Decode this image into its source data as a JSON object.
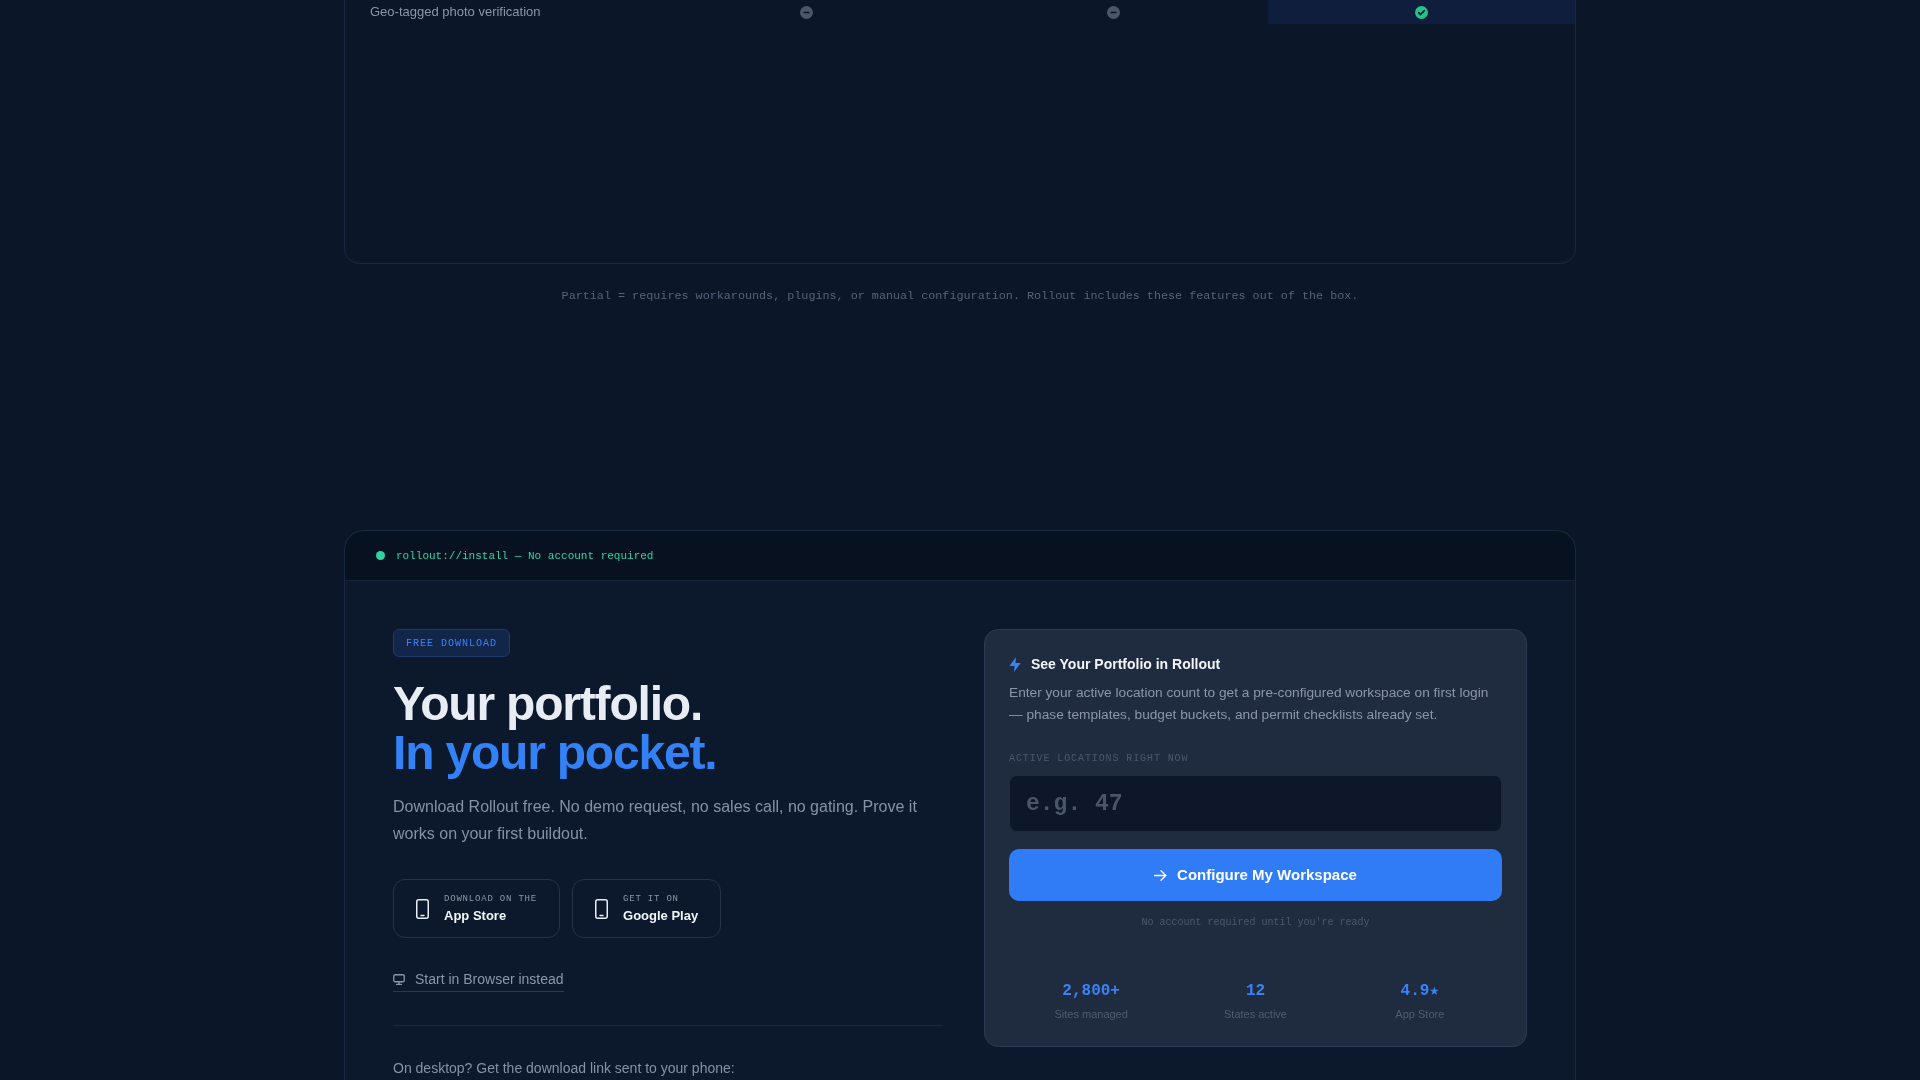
{
  "comparison_table": {
    "rows": [
      {
        "feature": "Geo-tagged photo verification",
        "cells": [
          {
            "kind": "no",
            "highlighted": false
          },
          {
            "kind": "no",
            "highlighted": false
          },
          {
            "kind": "yes",
            "highlighted": true
          }
        ]
      }
    ],
    "footnote": "Partial = requires workarounds, plugins, or manual configuration. Rollout includes these features out of the box."
  },
  "install_panel": {
    "terminal_bar": {
      "text": "rollout://install — No account required"
    },
    "badge": "FREE DOWNLOAD",
    "headline": {
      "line_1": "Your portfolio.",
      "line_2": "In your pocket."
    },
    "description": "Download Rollout free. No demo request, no sales call, no gating. Prove it works on your first buildout.",
    "store_buttons": [
      {
        "caption": "DOWNLOAD ON THE",
        "label": "App Store"
      },
      {
        "caption": "GET IT ON",
        "label": "Google Play"
      }
    ],
    "browser_link": "Start in Browser instead",
    "desktop_prompt": "On desktop? Get the download link sent to your phone:",
    "workspace_card": {
      "title": "See Your Portfolio in Rollout",
      "description": "Enter your active location count to get a pre-configured workspace on first login — phase templates, budget buckets, and permit checklists already set.",
      "field": {
        "label": "ACTIVE LOCATIONS RIGHT NOW",
        "placeholder": "e.g. 47"
      },
      "button": "Configure My Workspace",
      "note": "No account required until you're ready",
      "stats": [
        {
          "value": "2,800+",
          "label": "Sites managed"
        },
        {
          "value": "12",
          "label": "States active"
        },
        {
          "value": "4.9★",
          "label": "App Store"
        }
      ]
    }
  }
}
